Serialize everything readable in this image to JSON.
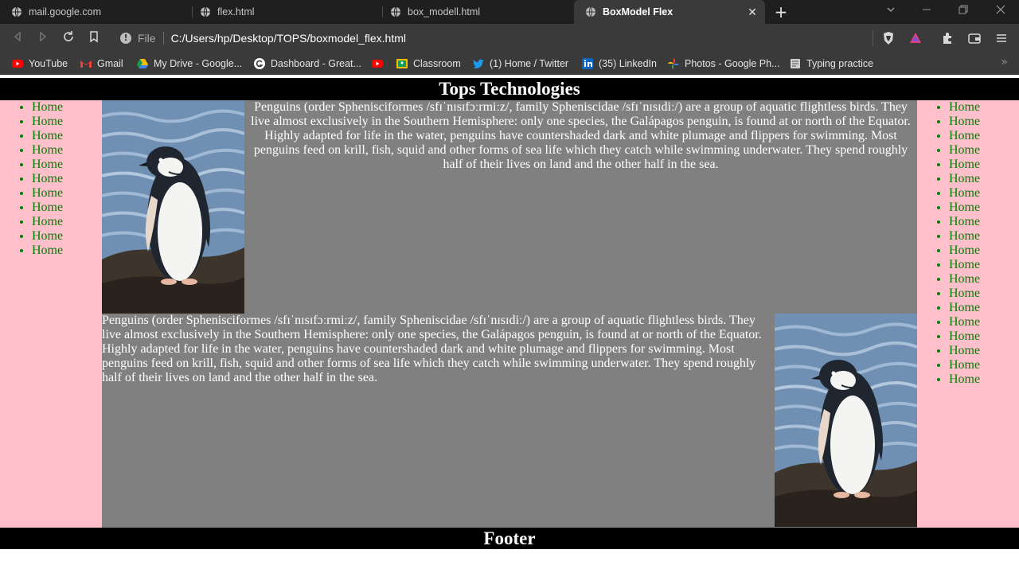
{
  "browser": {
    "tabs": [
      {
        "title": "mail.google.com",
        "icon": "globe-icon",
        "active": false
      },
      {
        "title": "flex.html",
        "icon": "globe-icon",
        "active": false
      },
      {
        "title": "box_modell.html",
        "icon": "globe-icon",
        "active": false
      },
      {
        "title": "BoxModel Flex",
        "icon": "globe-icon",
        "active": true
      }
    ],
    "new_tab_label": "+",
    "address": {
      "scheme_label": "File",
      "url": "C:/Users/hp/Desktop/TOPS/boxmodel_flex.html"
    },
    "bookmarks": [
      {
        "label": "YouTube",
        "icon": "youtube-icon"
      },
      {
        "label": "Gmail",
        "icon": "gmail-icon"
      },
      {
        "label": "My Drive - Google...",
        "icon": "google-drive-icon"
      },
      {
        "label": "Dashboard - Great...",
        "icon": "g-circle-icon"
      },
      {
        "label": "",
        "icon": "youtube-icon"
      },
      {
        "label": "Classroom",
        "icon": "classroom-icon"
      },
      {
        "label": "(1) Home / Twitter",
        "icon": "twitter-icon"
      },
      {
        "label": "(35) LinkedIn",
        "icon": "linkedin-icon"
      },
      {
        "label": "Photos - Google Ph...",
        "icon": "google-photos-icon"
      },
      {
        "label": "Typing practice",
        "icon": "keyboard-icon"
      }
    ],
    "colors": {
      "tabstrip": "#1f1f1f",
      "toolbar": "#3a3a3a"
    }
  },
  "page": {
    "header": "Tops Technologies",
    "left_nav": [
      "Home",
      "Home",
      "Home",
      "Home",
      "Home",
      "Home",
      "Home",
      "Home",
      "Home",
      "Home",
      "Home"
    ],
    "right_nav": [
      "Home",
      "Home",
      "Home",
      "Home",
      "Home",
      "Home",
      "Home",
      "Home",
      "Home",
      "Home",
      "Home",
      "Home",
      "Home",
      "Home",
      "Home",
      "Home",
      "Home",
      "Home",
      "Home",
      "Home"
    ],
    "paragraph_1": "Penguins (order Sphenisciformes /sfɪˈnɪsɪfɔːrmiːz/, family Spheniscidae /sfɪˈnɪsɪdiː/) are a group of aquatic flightless birds. They live almost exclusively in the Southern Hemisphere: only one species, the Galápagos penguin, is found at or north of the Equator. Highly adapted for life in the water, penguins have countershaded dark and white plumage and flippers for swimming. Most penguins feed on krill, fish, squid and other forms of sea life which they catch while swimming underwater. They spend roughly half of their lives on land and the other half in the sea.",
    "paragraph_2": "Penguins (order Sphenisciformes /sfɪˈnɪsɪfɔːrmiːz/, family Spheniscidae /sfɪˈnɪsɪdiː/) are a group of aquatic flightless birds. They live almost exclusively in the Southern Hemisphere: only one species, the Galápagos penguin, is found at or north of the Equator. Highly adapted for life in the water, penguins have countershaded dark and white plumage and flippers for swimming. Most penguins feed on krill, fish, squid and other forms of sea life which they catch while swimming underwater. They spend roughly half of their lives on land and the other half in the sea.",
    "footer": "Footer",
    "colors": {
      "header_bg": "#000000",
      "nav_bg": "#ffc0cb",
      "nav_link": "#008000",
      "main_bg": "#808080",
      "text": "#ffffff"
    }
  }
}
